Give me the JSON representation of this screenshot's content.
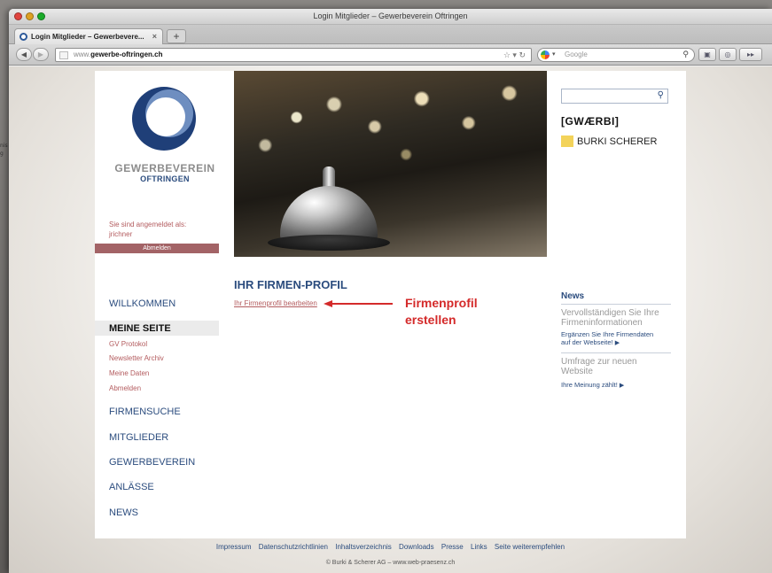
{
  "window": {
    "title": "Login Mitglieder – Gewerbeverein Oftringen"
  },
  "tab": {
    "label": "Login Mitglieder – Gewerbevere..."
  },
  "address_bar": {
    "prefix": "www.",
    "domain": "gewerbe-oftringen.ch"
  },
  "browser_search": {
    "placeholder": "Google"
  },
  "background_window": {
    "snippet1": "nis",
    "snippet2": "g"
  },
  "logo": {
    "line1": "GEWERBEVEREIN",
    "line2": "OFTRINGEN"
  },
  "login": {
    "label": "Sie sind angemeldet als:",
    "user": "jrichner",
    "logout": "Abmelden"
  },
  "sponsors": {
    "first": "[GWÆRBI]",
    "second": "BURKI SCHERER"
  },
  "content": {
    "title": "IHR FIRMEN-PROFIL",
    "edit_link": "Ihr Firmenprofil bearbeiten"
  },
  "annotation": {
    "line1": "Firmenprofil",
    "line2": "erstellen",
    "color": "#d42a2a"
  },
  "nav": {
    "willkommen": "WILLKOMMEN",
    "meine_seite": "MEINE SEITE",
    "sub": [
      "GV Protokol",
      "Newsletter Archiv",
      "Meine Daten",
      "Abmelden"
    ],
    "firmensuche": "FIRMENSUCHE",
    "mitglieder": "MITGLIEDER",
    "gewerbeverein": "GEWERBEVEREIN",
    "anlaesse": "ANLÄSSE",
    "news": "NEWS"
  },
  "news": {
    "title": "News",
    "item1_line1": "Vervollständigen Sie Ihre",
    "item1_line2": "Firmeninformationen",
    "item1_link_line1": "Ergänzen Sie Ihre Firmendaten",
    "item1_link_line2": "auf der Webseite!",
    "item2_line1": "Umfrage zur neuen",
    "item2_line2": "Website",
    "item2_link": "Ihre Meinung zählt!"
  },
  "footer": {
    "links": [
      "Impressum",
      "Datenschutzrichtlinien",
      "Inhaltsverzeichnis",
      "Downloads",
      "Presse",
      "Links",
      "Seite weiterempfehlen"
    ],
    "copyright": "© Burki & Scherer AG  –  www.web-praesenz.ch"
  },
  "colors": {
    "brand_blue": "#2b4c7e",
    "accent_red": "#b35b5e",
    "logout_bar": "#a36366"
  }
}
